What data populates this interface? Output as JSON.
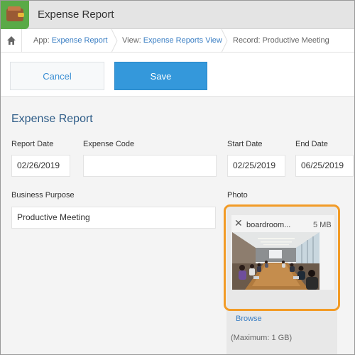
{
  "app": {
    "title": "Expense Report",
    "icon": "wallet-icon"
  },
  "breadcrumb": {
    "app_prefix": "App: ",
    "app_name": "Expense Report",
    "view_prefix": "View: ",
    "view_name": "Expense Reports View",
    "record": "Record: Productive Meeting"
  },
  "toolbar": {
    "cancel_label": "Cancel",
    "save_label": "Save"
  },
  "form": {
    "section_title": "Expense Report",
    "report_date": {
      "label": "Report Date",
      "value": "02/26/2019"
    },
    "expense_code": {
      "label": "Expense Code",
      "value": ""
    },
    "start_date": {
      "label": "Start Date",
      "value": "02/25/2019"
    },
    "end_date": {
      "label": "End Date",
      "value": "06/25/2019"
    },
    "business_purpose": {
      "label": "Business Purpose",
      "value": "Productive Meeting"
    },
    "photo": {
      "label": "Photo",
      "file_name": "boardroom...",
      "file_size": "5 MB",
      "browse_label": "Browse",
      "max_note": "(Maximum: 1 GB)"
    }
  },
  "colors": {
    "accent": "#3498db",
    "link": "#3b7fc4",
    "highlight": "#f29b26",
    "app_icon_bg": "#5aaa47",
    "section_title": "#2f5d88"
  }
}
